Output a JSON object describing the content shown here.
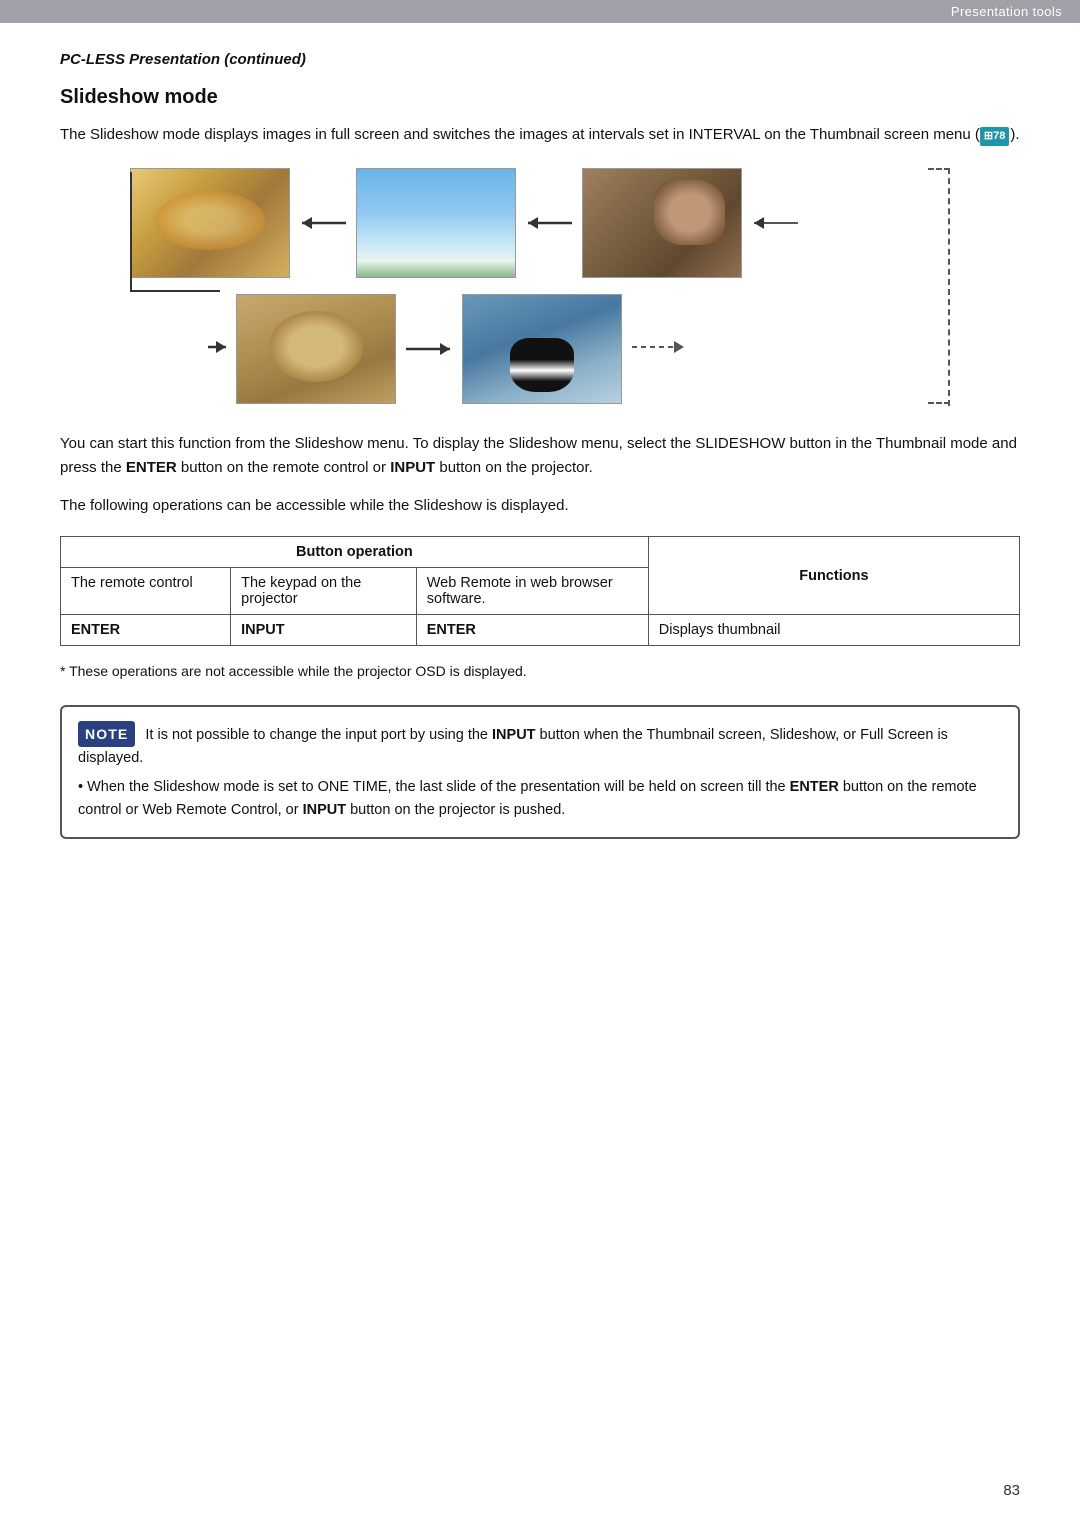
{
  "header": {
    "label": "Presentation tools"
  },
  "page": {
    "subtitle": "PC-LESS Presentation (continued)",
    "section_title": "Slideshow mode",
    "intro_text": "The Slideshow mode displays images in full screen and switches the images at intervals set in INTERVAL on the Thumbnail screen menu (",
    "intro_link_text": "78",
    "intro_text_end": ").",
    "body_text1": "You can start this function from the Slideshow menu. To display the Slideshow menu, select the SLIDESHOW button in the Thumbnail mode and press the ",
    "body_bold1": "ENTER",
    "body_text2": " button on the remote control or ",
    "body_bold2": "INPUT",
    "body_text3": " button on the projector.",
    "body_text4": "The following operations can be accessible while the Slideshow is displayed.",
    "asterisk_text": "* These operations are not accessible while the projector OSD is displayed.",
    "table": {
      "header_button_op": "Button operation",
      "header_functions": "Functions",
      "col_remote": "The remote control",
      "col_keypad": "The keypad on the projector",
      "col_web": "Web Remote in web browser software.",
      "row1_remote": "ENTER",
      "row1_keypad": "INPUT",
      "row1_web": "ENTER",
      "row1_func": "Displays thumbnail"
    },
    "note": {
      "label": "NOTE",
      "bullet1": "It is not possible to change the input port by using the ",
      "bullet1_bold": "INPUT",
      "bullet1_end": " button when the Thumbnail screen, Slideshow, or Full Screen is displayed.",
      "bullet2": "When the Slideshow mode is set to ONE TIME, the last slide of the presentation will be held on screen till the ",
      "bullet2_bold1": "ENTER",
      "bullet2_mid": " button on the remote control or Web Remote Control, or ",
      "bullet2_bold2": "INPUT",
      "bullet2_end": " button on the projector is pushed."
    },
    "page_number": "83"
  }
}
